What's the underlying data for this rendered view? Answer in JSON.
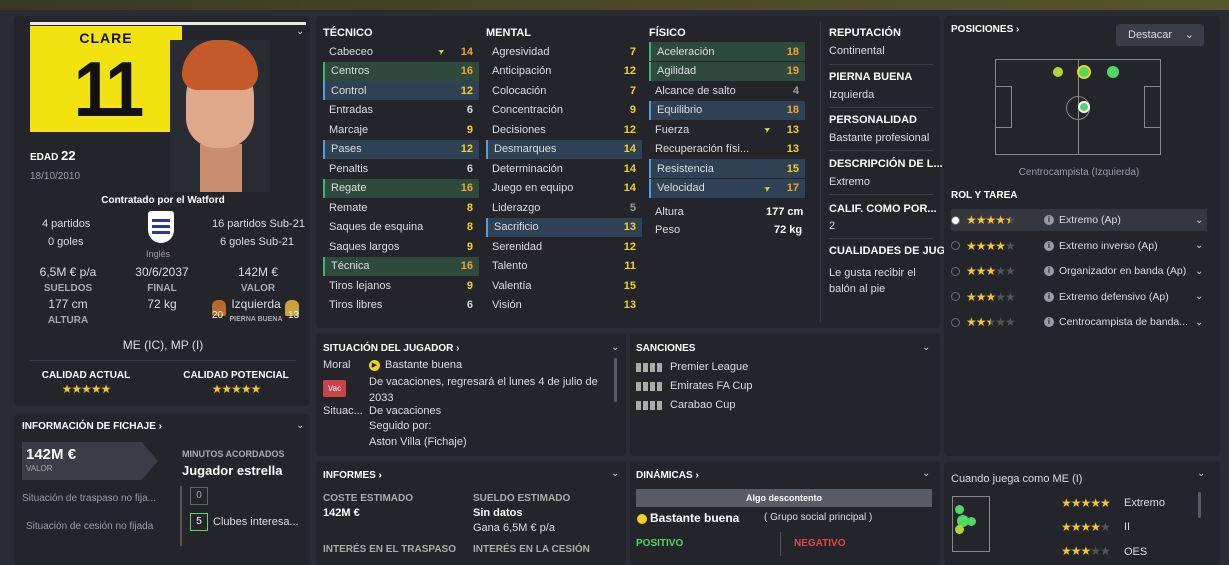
{
  "player": {
    "name": "CLARE",
    "number": "11",
    "age_label": "EDAD",
    "age": "22",
    "dob": "18/10/2010",
    "signed": "Contratado por el Watford",
    "caps": "4 partidos",
    "goals": "0 goles",
    "u21_caps": "16 partidos Sub-21",
    "u21_goals": "6 goles Sub-21",
    "nationality": "Inglés",
    "wage": "6,5M € p/a",
    "wage_label": "SUELDOS",
    "contract": "30/6/2037",
    "contract_label": "FINAL",
    "value": "142M €",
    "value_label": "VALOR",
    "height": "177 cm",
    "height_label": "ALTURA",
    "weight": "72 kg",
    "foot": "Izquierda",
    "foot_label": "PIERNA BUENA",
    "left_foot": "20",
    "right_foot": "13",
    "positions": "ME (IC), MP (I)",
    "current_ability": "CALIDAD ACTUAL",
    "potential_ability": "CALIDAD POTENCIAL"
  },
  "transfer": {
    "title": "INFORMACIÓN DE FICHAJE",
    "value": "142M €",
    "value_label": "VALOR",
    "minutes_label": "MINUTOS ACORDADOS",
    "minutes": "Jugador estrella",
    "status1": "Situación de traspaso no fija...",
    "status2": "Situación de cesión no fijada",
    "count0": "0",
    "count5": "5",
    "clubs": "Clubes interesa..."
  },
  "columns": {
    "tech": "TÉCNICO",
    "mental": "MENTAL",
    "phys": "FÍSICO"
  },
  "technical": [
    {
      "n": "Cabeceo",
      "v": "14",
      "c": "o",
      "h": "",
      "arrow": true
    },
    {
      "n": "Centros",
      "v": "16",
      "c": "o",
      "h": "g"
    },
    {
      "n": "Control",
      "v": "12",
      "c": "y",
      "h": "b"
    },
    {
      "n": "Entradas",
      "v": "6",
      "c": "w",
      "h": ""
    },
    {
      "n": "Marcaje",
      "v": "9",
      "c": "y",
      "h": ""
    },
    {
      "n": "Pases",
      "v": "12",
      "c": "y",
      "h": "b"
    },
    {
      "n": "Penaltis",
      "v": "6",
      "c": "w",
      "h": ""
    },
    {
      "n": "Regate",
      "v": "16",
      "c": "o",
      "h": "g"
    },
    {
      "n": "Remate",
      "v": "8",
      "c": "y",
      "h": ""
    },
    {
      "n": "Saques de esquina",
      "v": "8",
      "c": "y",
      "h": ""
    },
    {
      "n": "Saques largos",
      "v": "9",
      "c": "y",
      "h": ""
    },
    {
      "n": "Técnica",
      "v": "16",
      "c": "o",
      "h": "g"
    },
    {
      "n": "Tiros lejanos",
      "v": "9",
      "c": "y",
      "h": ""
    },
    {
      "n": "Tiros libres",
      "v": "6",
      "c": "w",
      "h": ""
    }
  ],
  "mental": [
    {
      "n": "Agresividad",
      "v": "7",
      "c": "y",
      "h": ""
    },
    {
      "n": "Anticipación",
      "v": "12",
      "c": "y",
      "h": ""
    },
    {
      "n": "Colocación",
      "v": "7",
      "c": "y",
      "h": ""
    },
    {
      "n": "Concentración",
      "v": "9",
      "c": "y",
      "h": ""
    },
    {
      "n": "Decisiones",
      "v": "12",
      "c": "y",
      "h": ""
    },
    {
      "n": "Desmarques",
      "v": "14",
      "c": "y",
      "h": "b"
    },
    {
      "n": "Determinación",
      "v": "14",
      "c": "y",
      "h": ""
    },
    {
      "n": "Juego en equipo",
      "v": "14",
      "c": "y",
      "h": ""
    },
    {
      "n": "Liderazgo",
      "v": "5",
      "c": "g",
      "h": ""
    },
    {
      "n": "Sacrificio",
      "v": "13",
      "c": "y",
      "h": "b"
    },
    {
      "n": "Serenidad",
      "v": "12",
      "c": "y",
      "h": ""
    },
    {
      "n": "Talento",
      "v": "11",
      "c": "y",
      "h": ""
    },
    {
      "n": "Valentía",
      "v": "15",
      "c": "y",
      "h": ""
    },
    {
      "n": "Visión",
      "v": "13",
      "c": "y",
      "h": ""
    }
  ],
  "physical": [
    {
      "n": "Aceleración",
      "v": "18",
      "c": "o",
      "h": "g"
    },
    {
      "n": "Agilidad",
      "v": "19",
      "c": "o",
      "h": "g"
    },
    {
      "n": "Alcance de salto",
      "v": "4",
      "c": "g",
      "h": ""
    },
    {
      "n": "Equilibrio",
      "v": "18",
      "c": "o",
      "h": "b"
    },
    {
      "n": "Fuerza",
      "v": "13",
      "c": "y",
      "h": "",
      "arrow": true
    },
    {
      "n": "Recuperación físi...",
      "v": "13",
      "c": "y",
      "h": ""
    },
    {
      "n": "Resistencia",
      "v": "15",
      "c": "y",
      "h": "b"
    },
    {
      "n": "Velocidad",
      "v": "17",
      "c": "o",
      "h": "b",
      "arrow": true
    }
  ],
  "phys_extra": {
    "height_label": "Altura",
    "height": "177 cm",
    "weight_label": "Peso",
    "weight": "72 kg"
  },
  "info": {
    "rep_label": "REPUTACIÓN",
    "rep": "Continental",
    "foot_label": "PIERNA BUENA",
    "foot": "Izquierda",
    "pers_label": "PERSONALIDAD",
    "pers": "Bastante profesional",
    "desc_label": "DESCRIPCIÓN DE L...",
    "desc": "Extremo",
    "calif_label": "CALIF. COMO POR...",
    "calif": "2",
    "qual_label": "CUALIDADES DE JUG...",
    "qual": "Le gusta recibir el balón al pie"
  },
  "situation": {
    "title": "SITUACIÓN DEL JUGADOR",
    "moral_label": "Moral",
    "moral": "Bastante buena",
    "badge": "Vac",
    "line1": "De vacaciones, regresará el lunes 4 de julio de 2033",
    "sit_label": "Situac...",
    "sit": "De vacaciones",
    "followed": "Seguido por:",
    "club": "Aston Villa (Fichaje)"
  },
  "sanctions": {
    "title": "SANCIONES",
    "items": [
      "Premier League",
      "Emirates FA Cup",
      "Carabao Cup"
    ]
  },
  "reports": {
    "title": "INFORMES",
    "cost_label": "COSTE ESTIMADO",
    "cost": "142M €",
    "wage_label": "SUELDO ESTIMADO",
    "wage": "Sin datos",
    "wage2": "Gana 6,5M € p/a",
    "interest_transfer": "INTERÉS EN EL TRASPASO",
    "interest_loan": "INTERÉS EN LA CESIÓN"
  },
  "dynamics": {
    "title": "DINÁMICAS",
    "bar": "Algo descontento",
    "line": "Bastante buena",
    "group": "( Grupo social principal )",
    "pos": "POSITIVO",
    "neg": "NEGATIVO"
  },
  "positions": {
    "title": "POSICIONES",
    "button": "Destacar",
    "caption": "Centrocampista (Izquierda)"
  },
  "roles": {
    "title": "ROL Y TAREA",
    "items": [
      {
        "name": "Extremo (Ap)",
        "stars": 4.5
      },
      {
        "name": "Extremo inverso (Ap)",
        "stars": 4
      },
      {
        "name": "Organizador en banda (Ap)",
        "stars": 3
      },
      {
        "name": "Extremo defensivo (Ap)",
        "stars": 3
      },
      {
        "name": "Centrocampista de banda...",
        "stars": 2.5
      }
    ]
  },
  "when": {
    "title": "Cuando juega como ME (I)",
    "r1": "Extremo",
    "r2": "II",
    "r3": "OES"
  }
}
